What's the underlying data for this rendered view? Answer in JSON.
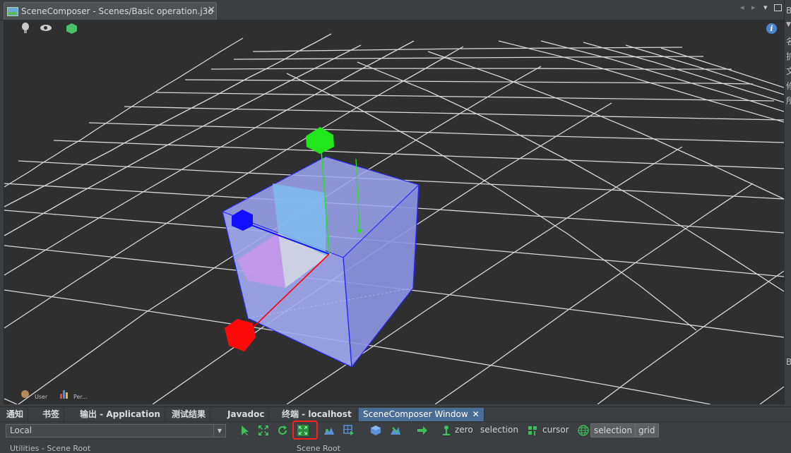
{
  "window": {
    "tab_title": "SceneComposer - Scenes/Basic operation.j3o",
    "tab_close": "✕",
    "controls": [
      "◂",
      "▸",
      "▾"
    ]
  },
  "viewport": {
    "toolbar_icons": [
      "light-bulb-icon",
      "eye-icon",
      "green-cube-icon"
    ],
    "info_label": "i",
    "overlay_labels": {
      "user": "User",
      "perf": "Per..."
    },
    "grid_color": "#d8d8d8",
    "background_color": "#2f2f2f",
    "gizmo": {
      "x_axis_color": "#ff0000",
      "y_axis_color": "#22e51b",
      "z_axis_color": "#1010ff",
      "box_fill": "#9ea6f2"
    }
  },
  "right_panel": {
    "lines": [
      "B",
      "▼",
      "名",
      "扩",
      "文",
      "修",
      "所",
      "B"
    ]
  },
  "bottom_tabs": [
    {
      "label": "通知"
    },
    {
      "label": "书签"
    },
    {
      "label": "输出 - Application"
    },
    {
      "label": "测试结果"
    },
    {
      "label": "Javadoc"
    },
    {
      "label": "终端 - localhost"
    },
    {
      "label": "SceneComposer Window",
      "active": true,
      "close": "✕"
    }
  ],
  "composer_toolbar": {
    "mode_value": "Local",
    "mode_arrow": "▼",
    "icons": [
      "select-arrow-icon",
      "move-icon",
      "rotate-icon",
      "scale-icon",
      "terrain-icon",
      "snap-icon",
      "add-spatial-icon",
      "bone-icon",
      "forward-arrow-icon",
      "zero-icon",
      "cursor-icon",
      "globe-icon"
    ],
    "zero_label": "zero",
    "selection_label": "selection",
    "cursor_label": "cursor",
    "toggle_selection": "selection",
    "toggle_grid": "grid",
    "highlight_color": "#ff1e1e"
  },
  "status": {
    "left": "Utilities - Scene Root",
    "mid": "Scene Root"
  }
}
